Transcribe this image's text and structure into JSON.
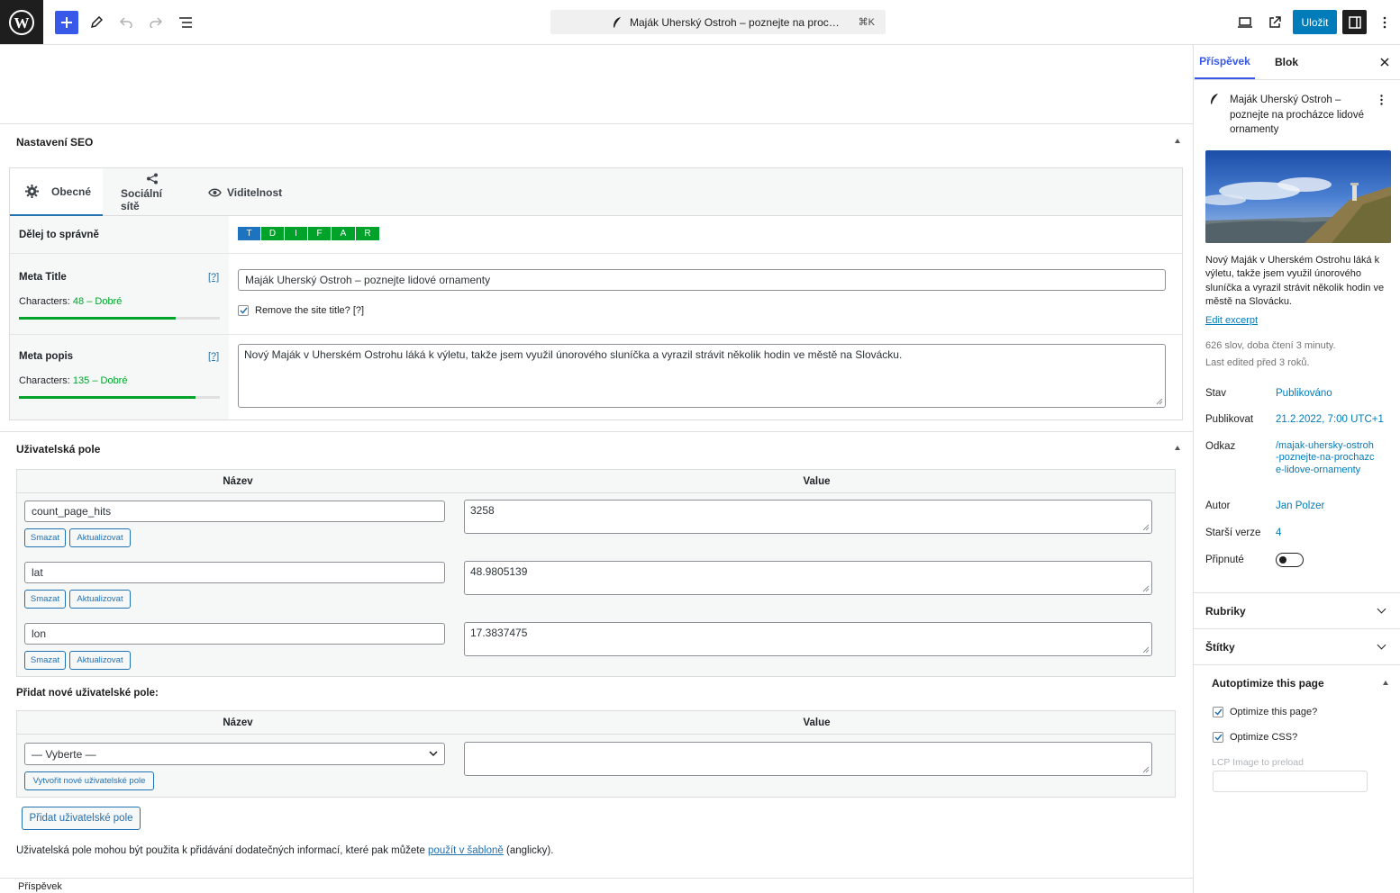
{
  "topbar": {
    "doc_title": "Maják Uherský Ostroh – poznejte na proc…",
    "shortcut": "⌘K",
    "save_label": "Uložit"
  },
  "seo": {
    "panel_title": "Nastavení SEO",
    "tabs": [
      "Obecné",
      "Sociální sítě",
      "Viditelnost"
    ],
    "do_it_right_label": "Dělej to správně",
    "letters": [
      "T",
      "D",
      "I",
      "F",
      "A",
      "R"
    ],
    "letter_colors": [
      "#1e73be",
      "#00a32a",
      "#00a32a",
      "#00a32a",
      "#00a32a",
      "#00a32a"
    ],
    "meta_title_label": "Meta Title",
    "help": "[?]",
    "meta_title_chars_prefix": "Characters: ",
    "meta_title_chars_value": "48 – Dobré",
    "meta_title_progress": 0.78,
    "meta_title_value": "Maják Uherský Ostroh – poznejte lidové ornamenty",
    "remove_site_title": "Remove the site title? [?]",
    "meta_desc_label": "Meta popis",
    "meta_desc_chars_prefix": "Characters: ",
    "meta_desc_chars_value": "135 – Dobré",
    "meta_desc_progress": 0.88,
    "meta_desc_value": "Nový Maják v Uherském Ostrohu láká k výletu, takže jsem využil únorového sluníčka a vyrazil strávit několik hodin ve městě na Slovácku."
  },
  "custom_fields": {
    "panel_title": "Uživatelská pole",
    "col_name": "Název",
    "col_value": "Value",
    "rows": [
      {
        "name": "count_page_hits",
        "value": "3258"
      },
      {
        "name": "lat",
        "value": "48.9805139"
      },
      {
        "name": "lon",
        "value": "17.3837475"
      }
    ],
    "delete_label": "Smazat",
    "update_label": "Aktualizovat",
    "add_new_heading": "Přidat nové uživatelské pole:",
    "select_placeholder": "— Vyberte —",
    "create_new_label": "Vytvořit nové uživatelské pole",
    "add_button": "Přidat uživatelské pole",
    "help_text_before": "Uživatelská pole mohou být použita k přidávání dodatečných informací, které pak můžete ",
    "help_link": "použít v šabloně",
    "help_text_after": " (anglicky)."
  },
  "sidebar": {
    "tab_post": "Příspěvek",
    "tab_block": "Blok",
    "post_title": "Maják Uherský Ostroh – poznejte na procházce lidové ornamenty",
    "excerpt": "Nový Maják v Uherském Ostrohu láká k výletu, takže jsem využil únorového sluníčka a vyrazil strávit několik hodin ve městě na Slovácku.",
    "edit_excerpt": "Edit excerpt",
    "stats_line1": "626 slov, doba čtení 3 minuty.",
    "stats_line2": "Last edited před 3 roků.",
    "status_label": "Stav",
    "status_value": "Publikováno",
    "publish_label": "Publikovat",
    "publish_value": "21.2.2022, 7:00 UTC+1",
    "link_label": "Odkaz",
    "link_value": "/majak-uhersky-ostroh-poznejte-na-prochazce-lidove-ornamenty",
    "author_label": "Autor",
    "author_value": "Jan Polzer",
    "revisions_label": "Starší verze",
    "revisions_value": "4",
    "sticky_label": "Připnuté",
    "categories": "Rubriky",
    "tags": "Štítky",
    "autoptimize_title": "Autoptimize this page",
    "optimize_page": "Optimize this page?",
    "optimize_css": "Optimize CSS?",
    "lcp_placeholder": "LCP Image to preload"
  },
  "footer": {
    "breadcrumb": "Příspěvek"
  }
}
